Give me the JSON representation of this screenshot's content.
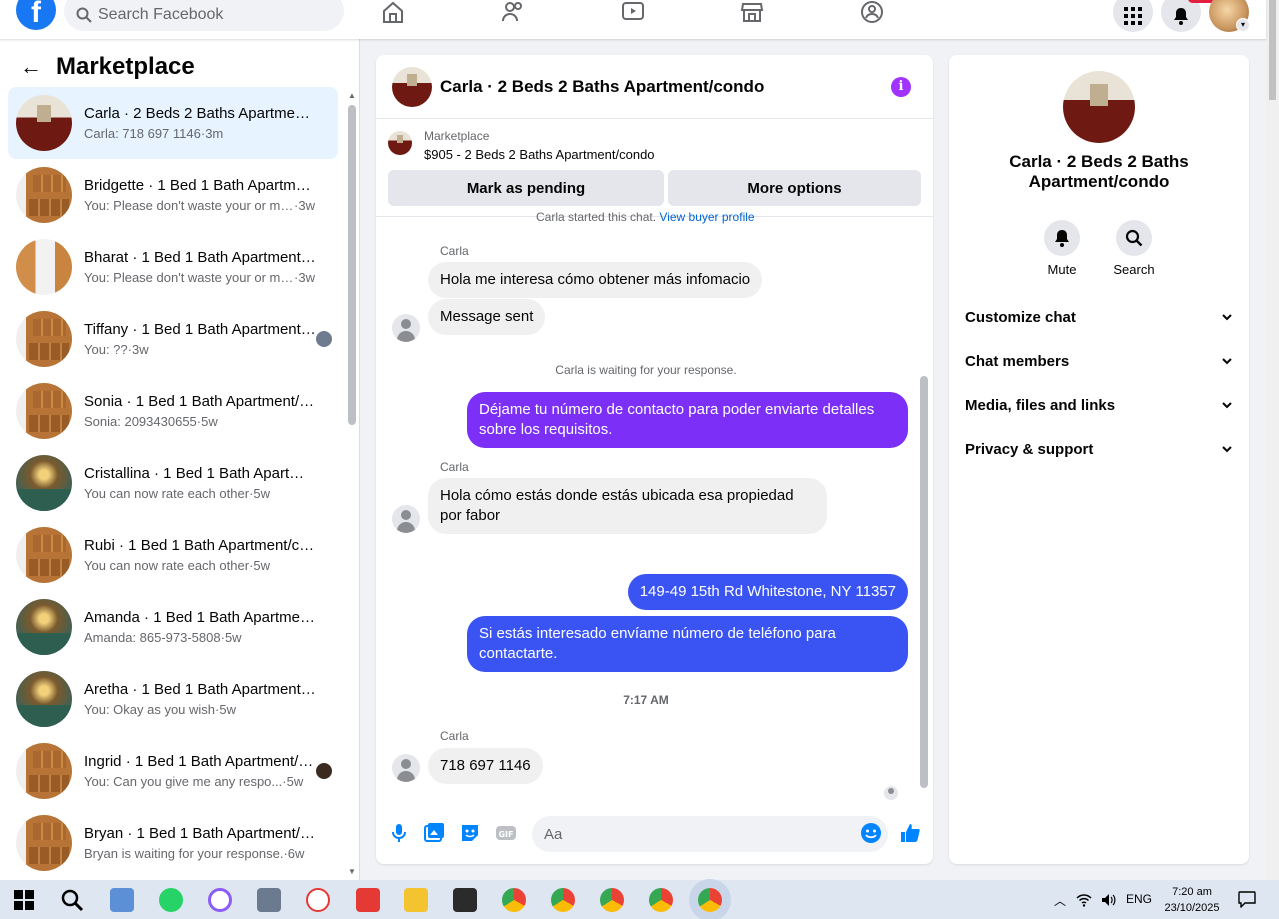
{
  "topbar": {
    "logo": "f",
    "search_placeholder": "Search Facebook",
    "nav_icons": [
      "home-icon",
      "friends-icon",
      "watch-icon",
      "marketplace-icon",
      "groups-icon"
    ],
    "right_icons": [
      "menu-grid-icon",
      "notifications-bell-icon"
    ]
  },
  "sidebar": {
    "title": "Marketplace",
    "conversations": [
      {
        "title": "Carla · 2 Beds 2 Baths Apartment/condo",
        "preview": "Carla: 718 697 1146",
        "time": "3m",
        "thumb": "living",
        "active": true
      },
      {
        "title": "Bridgette · 1 Bed 1 Bath Apartment/condo",
        "preview": "You: Please don't waste your or my...",
        "time": "3w",
        "thumb": "kitchen"
      },
      {
        "title": "Bharat · 1 Bed 1 Bath Apartment/condo",
        "preview": "You: Please don't waste your or my...",
        "time": "3w",
        "thumb": "kitchen2"
      },
      {
        "title": "Tiffany · 1 Bed 1 Bath Apartment/condo",
        "preview": "You: ??",
        "time": "3w",
        "thumb": "kitchen",
        "seen": "#6f7c8f"
      },
      {
        "title": "Sonia · 1 Bed 1 Bath Apartment/condo",
        "preview": "Sonia: 2093430655",
        "time": "5w",
        "thumb": "kitchen"
      },
      {
        "title": "Cristallina · 1 Bed 1 Bath Apartment/condo",
        "preview": "You can now rate each other",
        "time": "5w",
        "thumb": "lobby"
      },
      {
        "title": "Rubi · 1 Bed 1 Bath Apartment/condo",
        "preview": "You can now rate each other",
        "time": "5w",
        "thumb": "kitchen"
      },
      {
        "title": "Amanda · 1 Bed 1 Bath Apartment/condo",
        "preview": "Amanda: 865-973-5808",
        "time": "5w",
        "thumb": "lobby"
      },
      {
        "title": "Aretha · 1 Bed 1 Bath Apartment/condo",
        "preview": "You: Okay as you wish",
        "time": "5w",
        "thumb": "lobby"
      },
      {
        "title": "Ingrid · 1 Bed 1 Bath Apartment/condo",
        "preview": "You: Can you give me any respo...",
        "time": "5w",
        "thumb": "kitchen",
        "seen": "#3b2a1f"
      },
      {
        "title": "Bryan · 1 Bed 1 Bath Apartment/condo",
        "preview": "Bryan is waiting for your response.",
        "time": "6w",
        "thumb": "kitchen"
      }
    ]
  },
  "chat": {
    "title": "Carla · 2 Beds 2 Baths Apartment/condo",
    "info_icon": "i",
    "listing_label": "Marketplace",
    "listing_price": "$905 - 2 Beds 2 Baths Apartment/condo",
    "mark_pending": "Mark as pending",
    "more_options": "More options",
    "started_note": "Carla started this chat.",
    "view_profile": "View buyer profile",
    "messages": {
      "sender_1": "Carla",
      "in_1": "Hola me interesa cómo obtener más infomacio",
      "in_2": "Message sent",
      "waiting": "Carla is waiting for your response.",
      "out_1": "Déjame tu número de contacto para poder enviarte detalles sobre los requisitos.",
      "sender_2": "Carla",
      "in_3": "Hola cómo estás donde estás ubicada esa propiedad por fabor",
      "out_2": "149-49 15th Rd Whitestone, NY 11357",
      "out_3": "Si estás interesado envíame número de teléfono para contactarte.",
      "time": "7:17 AM",
      "sender_3": "Carla",
      "in_4": "718 697 1146"
    },
    "composer_placeholder": "Aa",
    "colors": {
      "purple": "#7b2ff7",
      "blue": "#3954f2",
      "accent": "#0084ff"
    }
  },
  "rpanel": {
    "title": "Carla · 2 Beds 2 Baths Apartment/condo",
    "mute": "Mute",
    "search": "Search",
    "rows": [
      "Customize chat",
      "Chat members",
      "Media, files and links",
      "Privacy & support"
    ]
  },
  "taskbar": {
    "lang": "ENG",
    "time": "7:20 am",
    "date": "23/10/2025"
  }
}
